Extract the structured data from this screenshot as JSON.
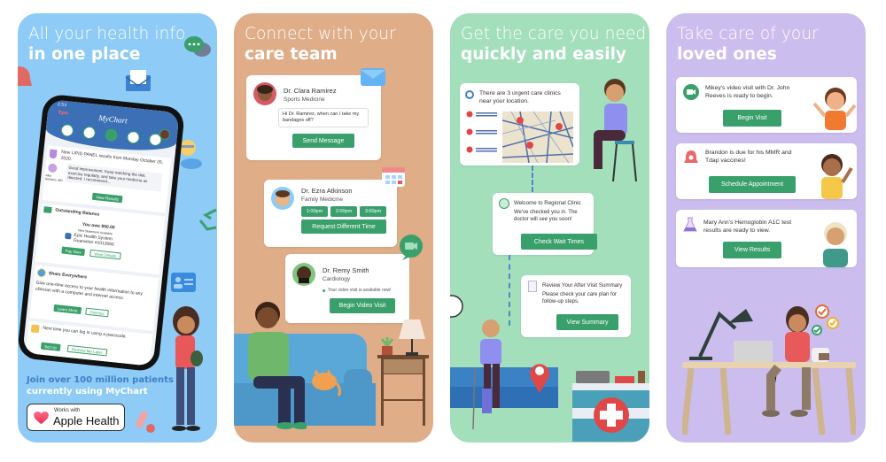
{
  "panels": [
    {
      "id": "all-your-health-info",
      "background": "#8ecbf6",
      "headline_light": "All your health info",
      "headline_bold": "in one place",
      "phone": {
        "app_title": "MyChart",
        "status_time": "2:53",
        "badge": "Epic",
        "cards": [
          {
            "title": "New LIPID PANEL results from Monday October 26, 2020.",
            "doctor": "Alex Romero, MD",
            "message": "Good improvement. Keep watching the diet, exercise regularly, and take your medicine as directed. I recommend...",
            "button": "View Results"
          },
          {
            "title": "Outstanding Balance",
            "amount": "You owe $50.00",
            "subtitle": "New Statement Available",
            "org": "Epic Health System",
            "guarantor": "Guarantor #1013066",
            "buttons": [
              "Pay Now",
              "View Details"
            ]
          },
          {
            "title": "Share Everywhere",
            "body": "Give one-time access to your health information to any clinician with a computer and internet access.",
            "buttons": [
              "Learn More",
              "Dismiss"
            ]
          },
          {
            "title": "Next time you can log in using a passcode.",
            "buttons": [
              "Set Up",
              "Remind Me Later"
            ]
          }
        ]
      },
      "tagline_line1": "Join over 100 million patients",
      "tagline_line2": "currently using MyChart",
      "apple_badge": {
        "small": "Works with",
        "large": "Apple Health"
      }
    },
    {
      "id": "connect-care-team",
      "background": "#dfad88",
      "headline_light": "Connect with your",
      "headline_bold": "care team",
      "cards": [
        {
          "doctor": "Dr. Clara Ramirez",
          "specialty": "Sports Medicine",
          "message": "Hi Dr. Ramirez, when can I take my bandages off?",
          "button": "Send Message"
        },
        {
          "doctor": "Dr. Ezra Atkinson",
          "specialty": "Family Medicine",
          "times": [
            "1:00pm",
            "2:00pm",
            "3:00pm"
          ],
          "button": "Request Different Time"
        },
        {
          "doctor": "Dr. Remy Smith",
          "specialty": "Cardiology",
          "status": "Your video visit is available now!",
          "button": "Begin Video Visit"
        }
      ]
    },
    {
      "id": "care-quickly",
      "background": "#a3dfbb",
      "headline_light": "Get the care you need",
      "headline_bold": "quickly and easily",
      "cards": [
        {
          "text": "There are 3 urgent care clinics near your location."
        },
        {
          "title": "Welcome to Regional Clinic",
          "text": "We've checked you in. The doctor will see you soon!",
          "button": "Check Wait Times"
        },
        {
          "title": "Review Your After Visit Summary",
          "text": "Please check your care plan for follow-up steps.",
          "button": "View Summary"
        }
      ]
    },
    {
      "id": "loved-ones",
      "background": "#cbbdee",
      "headline_light": "Take care of your",
      "headline_bold": "loved ones",
      "cards": [
        {
          "text": "Mikey's video visit with Dr. John Reeves is ready to begin.",
          "button": "Begin Visit"
        },
        {
          "text": "Brandon is due for his MMR and Tdap vaccines!",
          "button": "Schedule Appointment"
        },
        {
          "text": "Mary Ann's Hemoglobin A1C test results are ready to view.",
          "button": "View Results"
        }
      ]
    }
  ],
  "colors": {
    "button_green": "#3aa06b",
    "panel1": "#8ecbf6",
    "panel2": "#dfad88",
    "panel3": "#a3dfbb",
    "panel4": "#cbbdee"
  }
}
